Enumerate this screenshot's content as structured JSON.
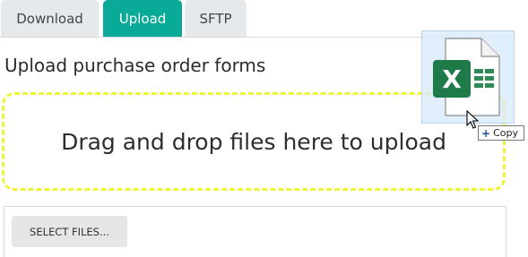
{
  "tabs": [
    {
      "label": "Download",
      "active": false
    },
    {
      "label": "Upload",
      "active": true
    },
    {
      "label": "SFTP",
      "active": false
    }
  ],
  "colors": {
    "accent": "#0aaa98",
    "inactive_tab": "#e6e9ec",
    "dropzone_border": "#f1f23a",
    "excel_green": "#1f7a4a"
  },
  "heading": "Upload purchase order forms",
  "dropzone": {
    "text": "Drag and drop files here to upload"
  },
  "select_files_label": "SELECT FILES...",
  "drag": {
    "file_icon": "excel-file-icon",
    "file_letter": "X",
    "cursor_icon": "arrow-cursor-icon",
    "tooltip_plus": "+",
    "tooltip_text": "Copy"
  }
}
